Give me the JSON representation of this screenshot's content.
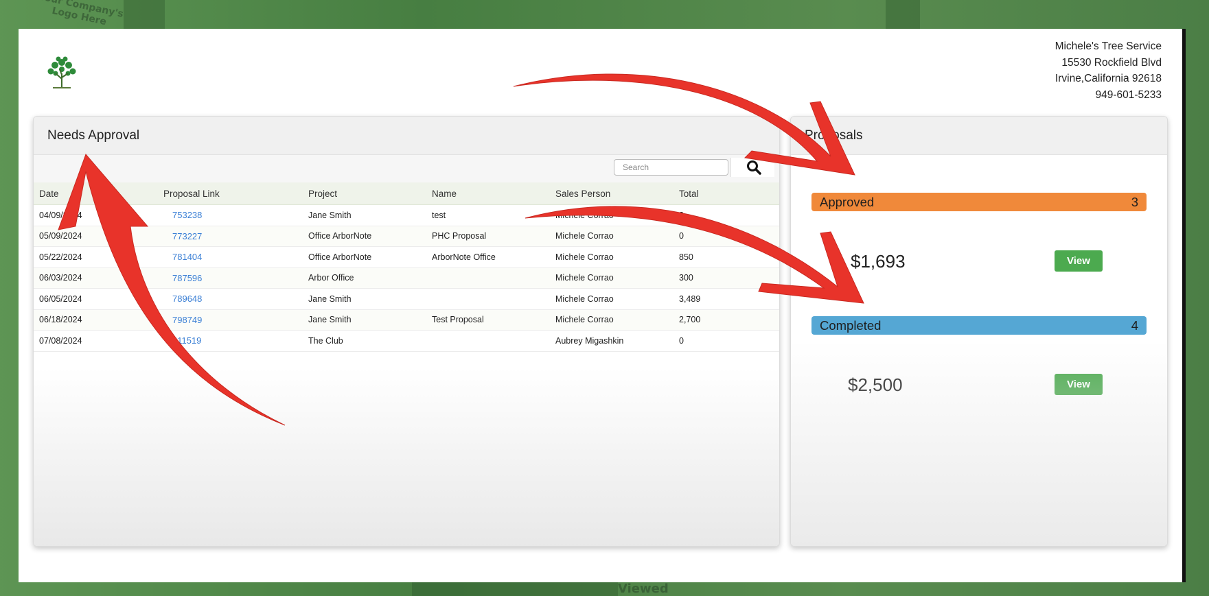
{
  "background": {
    "texts": [
      "Your Company's",
      "Logo Here",
      "Viewed"
    ]
  },
  "company": {
    "name": "Michele's Tree Service",
    "street": "15530 Rockfield Blvd",
    "city": "Irvine,California 92618",
    "phone": "949-601-5233"
  },
  "logo_icon": "tree-icon",
  "needs_approval": {
    "title": "Needs Approval",
    "search_placeholder": "Search",
    "search_icon": "magnifier-icon",
    "columns": [
      "Date",
      "Proposal Link",
      "Project",
      "Name",
      "Sales Person",
      "Total"
    ],
    "rows": [
      {
        "date": "04/09/2024",
        "link": "753238",
        "project": "Jane Smith",
        "name": "test",
        "sales": "Michele Corrao",
        "total": "2,..."
      },
      {
        "date": "05/09/2024",
        "link": "773227",
        "project": "Office ArborNote",
        "name": "PHC Proposal",
        "sales": "Michele Corrao",
        "total": "0"
      },
      {
        "date": "05/22/2024",
        "link": "781404",
        "project": "Office ArborNote",
        "name": "ArborNote Office",
        "sales": "Michele Corrao",
        "total": "850"
      },
      {
        "date": "06/03/2024",
        "link": "787596",
        "project": "Arbor Office",
        "name": "",
        "sales": "Michele Corrao",
        "total": "300"
      },
      {
        "date": "06/05/2024",
        "link": "789648",
        "project": "Jane Smith",
        "name": "",
        "sales": "Michele Corrao",
        "total": "3,489"
      },
      {
        "date": "06/18/2024",
        "link": "798749",
        "project": "Jane Smith",
        "name": "Test Proposal",
        "sales": "Michele Corrao",
        "total": "2,700"
      },
      {
        "date": "07/08/2024",
        "link": "811519",
        "project": "The Club",
        "name": "",
        "sales": "Aubrey Migashkin",
        "total": "0"
      }
    ]
  },
  "proposals": {
    "title": "Proposals",
    "approved": {
      "label": "Approved",
      "count": "3",
      "amount": "$1,693",
      "button": "View",
      "color": "#f0893a"
    },
    "completed": {
      "label": "Completed",
      "count": "4",
      "amount": "$2,500",
      "button": "View",
      "color": "#55a7d4"
    }
  },
  "annotation": {
    "arrow_color": "#e8332a",
    "arrow_icon": "red-arrow-icon"
  }
}
